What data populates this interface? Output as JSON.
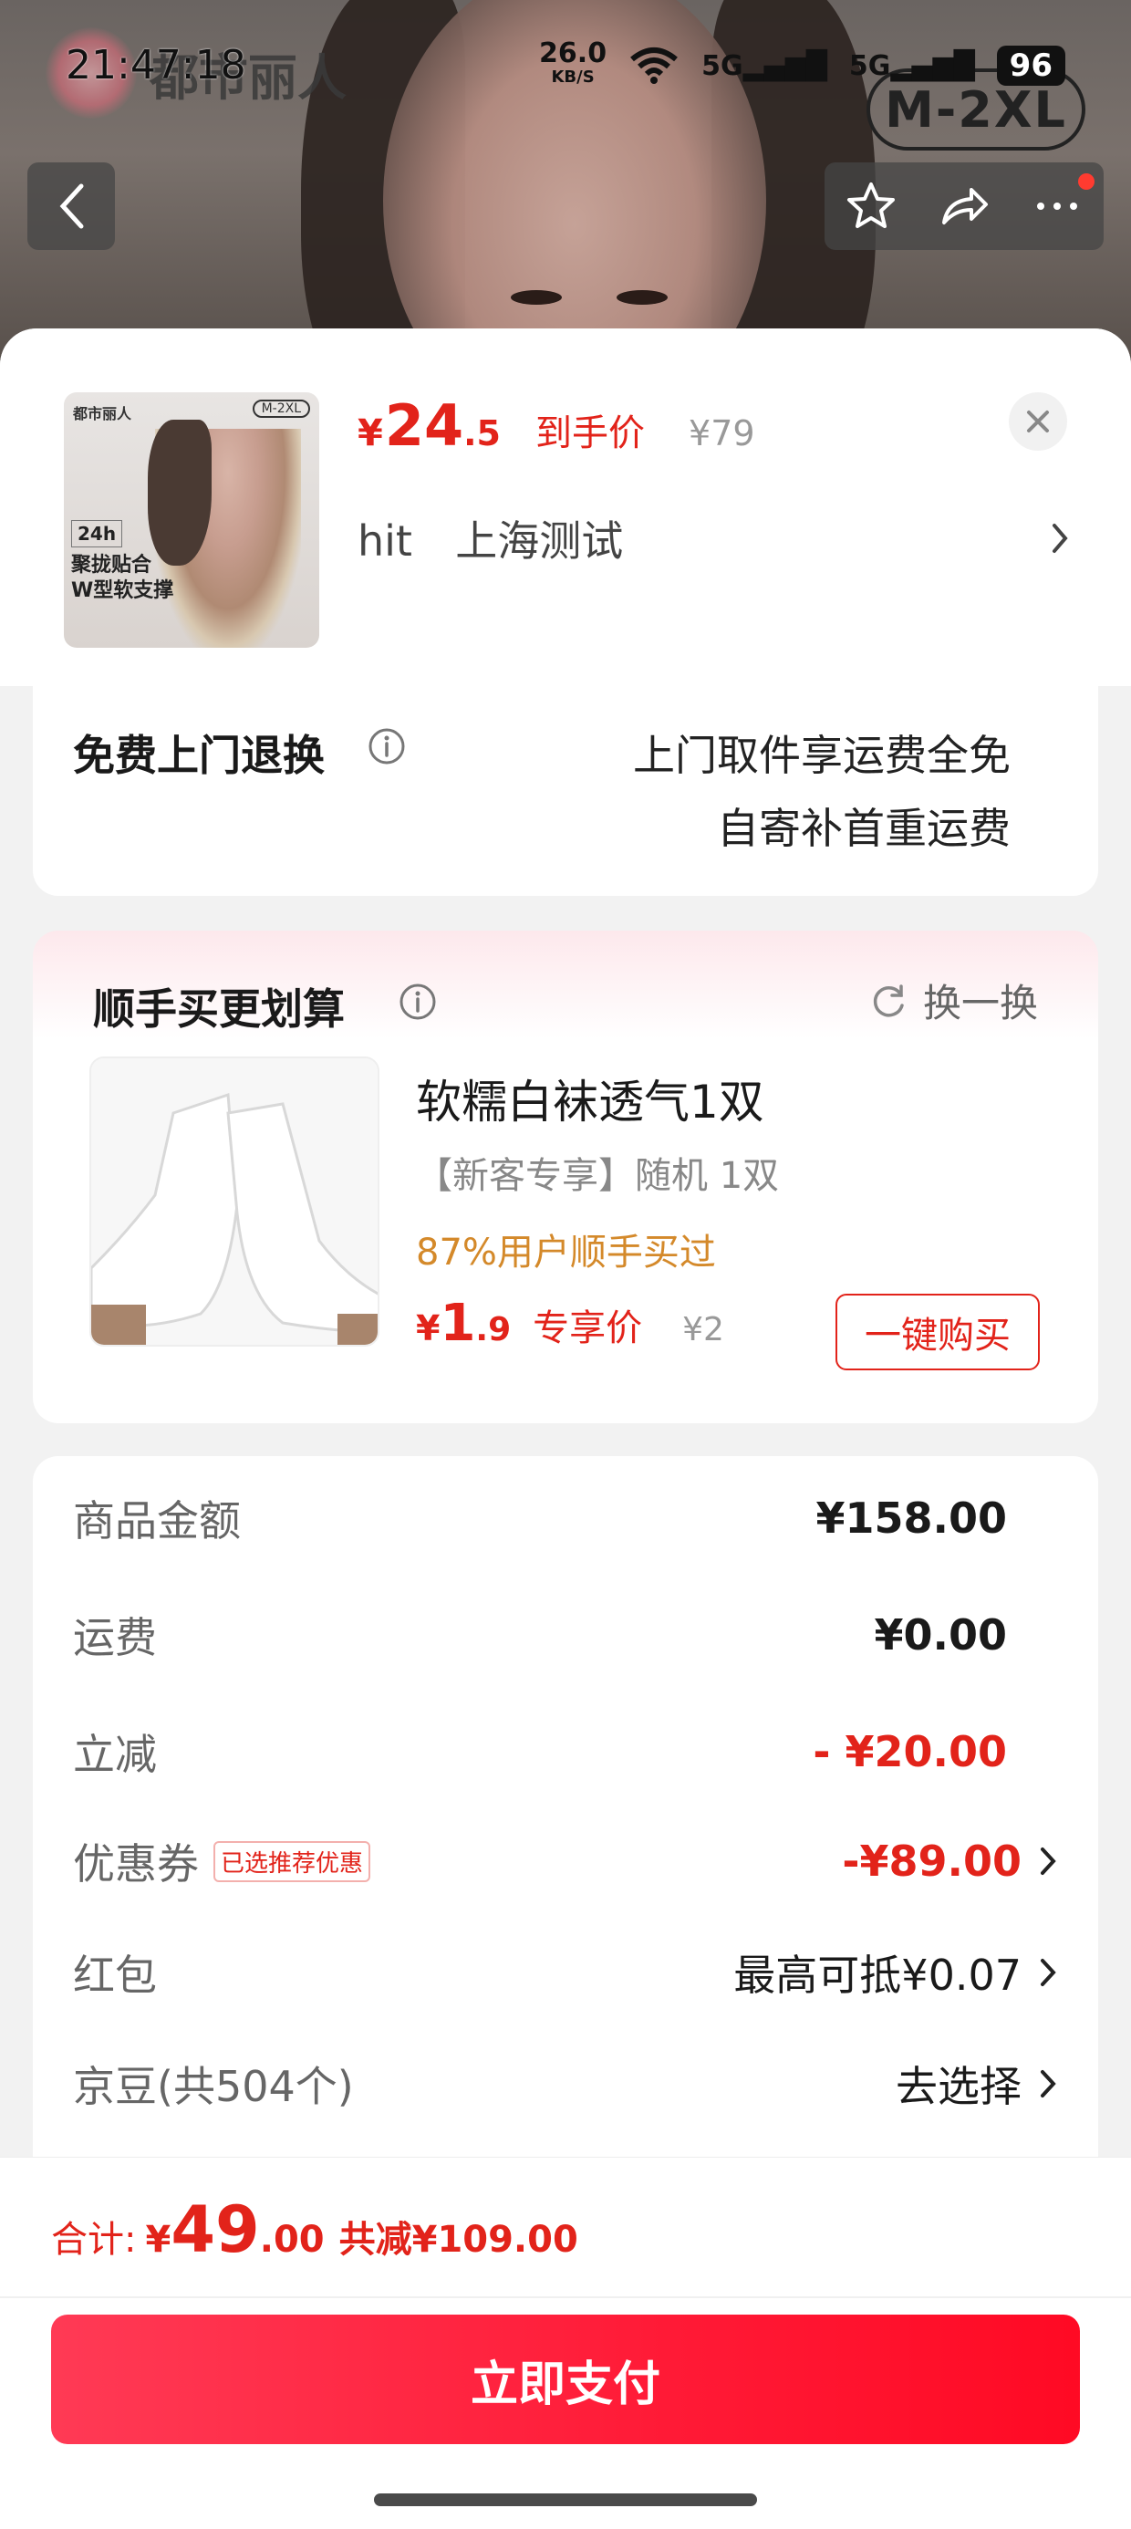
{
  "status_bar": {
    "time": "21:47:18",
    "net_speed": "26.0",
    "net_unit": "KB/S",
    "signal1": "5G",
    "signal2": "5G",
    "battery": "96"
  },
  "product_photo": {
    "brand": "都市丽人",
    "size_badge": "M-2XL"
  },
  "product": {
    "currency": "¥",
    "price_int": "24",
    "price_dec": ".5",
    "price_label": "到手价",
    "original_price": "¥79",
    "address_name": "hit",
    "address": "上海测试",
    "thumb_brand": "都市丽人",
    "thumb_size": "M-2XL",
    "thumb_badge": "24h",
    "thumb_text": "聚拢贴合\nW型软支撑"
  },
  "return_service": {
    "title": "免费上门退换",
    "line1": "上门取件享运费全免",
    "line2": "自寄补首重运费"
  },
  "addon": {
    "title": "顺手买更划算",
    "refresh_label": "换一换",
    "item_name": "软糯白袜透气1双",
    "item_sub": "【新客专享】随机 1双",
    "bought_rate": "87%用户顺手买过",
    "currency": "¥",
    "price_int": "1",
    "price_dec": ".9",
    "price_label": "专享价",
    "original_price": "¥2",
    "buy_label": "一键购买"
  },
  "summary": {
    "goods_amount_label": "商品金额",
    "goods_amount": "¥158.00",
    "shipping_label": "运费",
    "shipping": "¥0.00",
    "discount_label": "立减",
    "discount": "- ¥20.00",
    "coupon_label": "优惠券",
    "coupon_tag": "已选推荐优惠",
    "coupon": "-¥89.00",
    "redpacket_label": "红包",
    "redpacket": "最高可抵¥0.07",
    "jingdou_label": "京豆(共504个)",
    "jingdou": "去选择"
  },
  "footer": {
    "total_label": "合计:",
    "currency": "¥",
    "total_int": "49",
    "total_dec": ".00",
    "total_saved": "共减¥109.00",
    "pay_label": "立即支付"
  },
  "colors": {
    "accent_red": "#e2231a",
    "pay_button": "#ff1a36",
    "highlight_orange": "#d4892a"
  }
}
